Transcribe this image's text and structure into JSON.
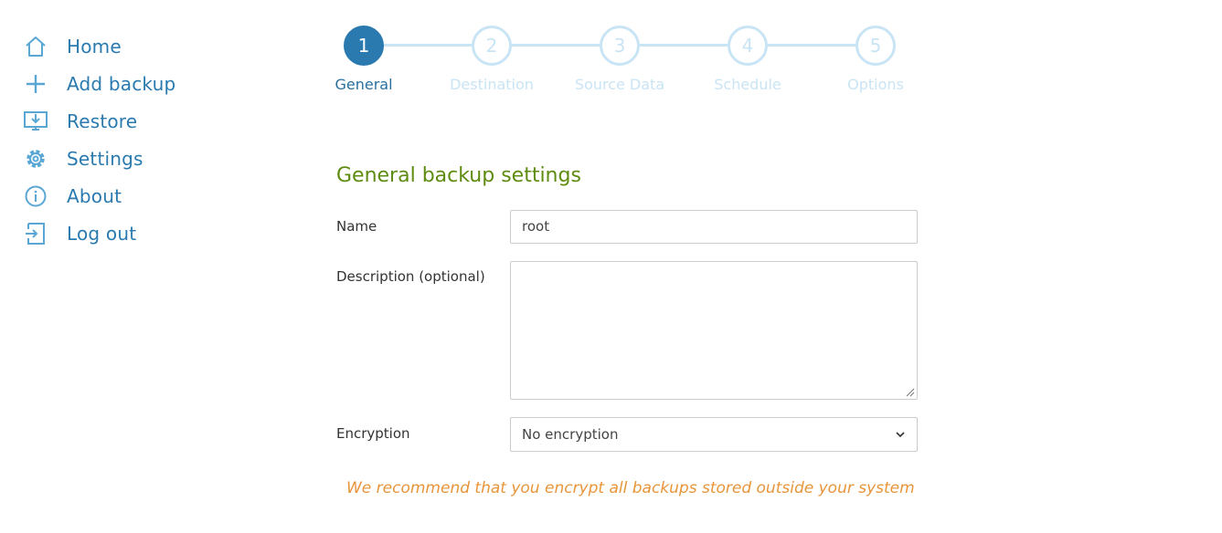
{
  "sidebar": {
    "items": [
      {
        "label": "Home",
        "icon": "home-icon"
      },
      {
        "label": "Add backup",
        "icon": "plus-icon"
      },
      {
        "label": "Restore",
        "icon": "restore-icon"
      },
      {
        "label": "Settings",
        "icon": "gear-icon"
      },
      {
        "label": "About",
        "icon": "info-icon"
      },
      {
        "label": "Log out",
        "icon": "logout-icon"
      }
    ]
  },
  "stepper": {
    "steps": [
      {
        "number": "1",
        "label": "General",
        "active": true
      },
      {
        "number": "2",
        "label": "Destination",
        "active": false
      },
      {
        "number": "3",
        "label": "Source Data",
        "active": false
      },
      {
        "number": "4",
        "label": "Schedule",
        "active": false
      },
      {
        "number": "5",
        "label": "Options",
        "active": false
      }
    ]
  },
  "form": {
    "title": "General backup settings",
    "name_label": "Name",
    "name_value": "root",
    "description_label": "Description (optional)",
    "description_value": "",
    "encryption_label": "Encryption",
    "encryption_value": "No encryption",
    "warning": "We recommend that you encrypt all backups stored outside your system"
  },
  "colors": {
    "accent": "#2a7ab0",
    "step_inactive": "#c9e4f4",
    "title_green": "#5e8c10",
    "warning_orange": "#e8953a"
  }
}
